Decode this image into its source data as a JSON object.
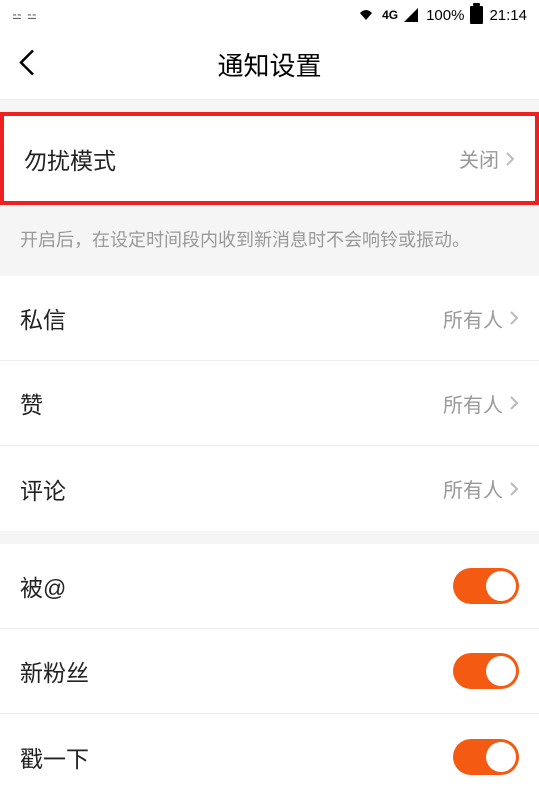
{
  "status_bar": {
    "left_indicator": "⚍  ⚍",
    "network": "4G",
    "battery_percent": "100%",
    "time": "21:14"
  },
  "nav": {
    "title": "通知设置"
  },
  "dnd": {
    "label": "勿扰模式",
    "value": "关闭"
  },
  "dnd_hint": "开启后，在设定时间段内收到新消息时不会响铃或振动。",
  "items": {
    "dm_label": "私信",
    "dm_value": "所有人",
    "like_label": "赞",
    "like_value": "所有人",
    "comment_label": "评论",
    "comment_value": "所有人",
    "mention_label": "被@",
    "follower_label": "新粉丝",
    "poke_label": "戳一下"
  }
}
